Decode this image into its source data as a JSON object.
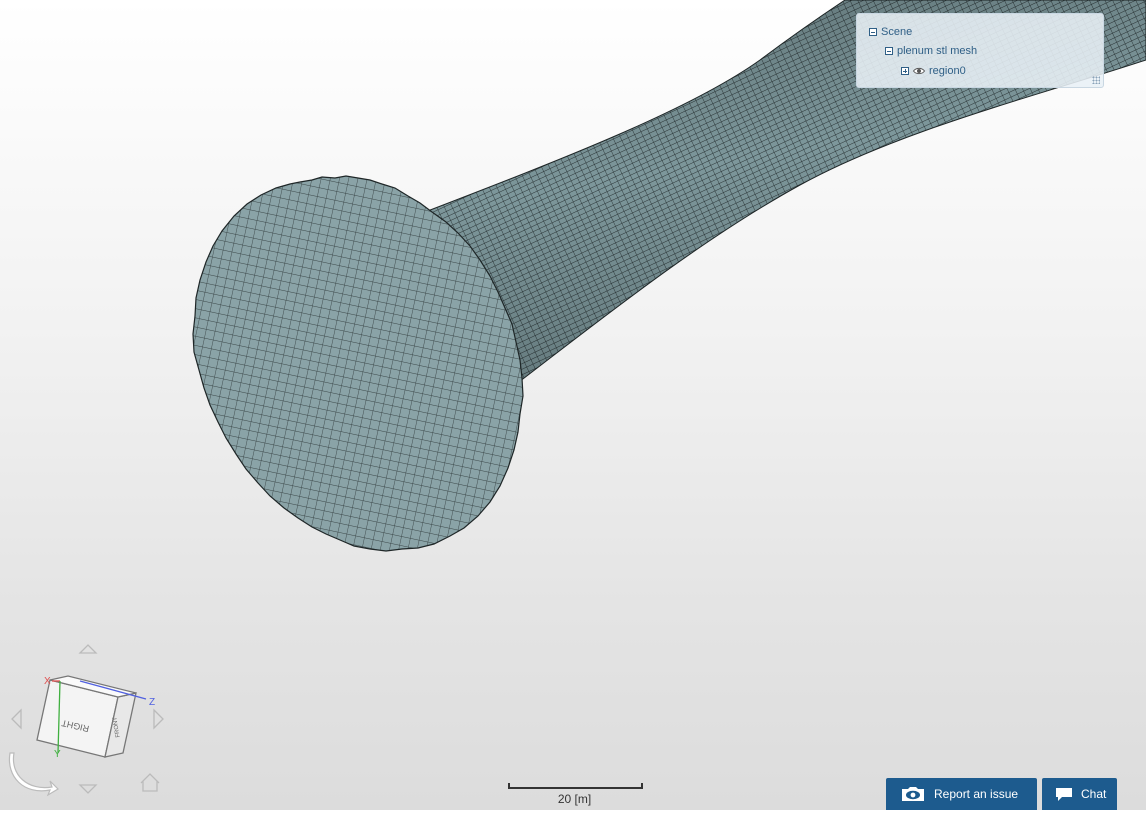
{
  "scene_tree": {
    "root": {
      "label": "Scene",
      "expanded": true
    },
    "mesh": {
      "label": "plenum stl mesh",
      "expanded": true
    },
    "region": {
      "label": "region0",
      "expanded": false,
      "visible": true
    }
  },
  "scale_bar": {
    "label": "20 [m]"
  },
  "buttons": {
    "report_issue": "Report an issue",
    "chat": "Chat"
  },
  "nav_cube": {
    "face_right": "RIGHT",
    "face_front": "FRONT",
    "axis_x": "X",
    "axis_y": "Y",
    "axis_z": "Z"
  },
  "colors": {
    "mesh_fill": "#7d979b",
    "mesh_face": "#8aa3a7",
    "mesh_line": "#2a3436",
    "button_bg": "#1d5b8e",
    "tree_text": "#2f5f86",
    "axis_x": "#e05050",
    "axis_y": "#40b040",
    "axis_z": "#5060e0"
  },
  "icons": {
    "tree_collapse": "minus-box-icon",
    "tree_expand": "plus-box-icon",
    "visibility": "eye-icon",
    "report": "camera-eye-icon",
    "chat": "speech-bubble-icon",
    "home": "home-icon",
    "rotate": "rotate-arrow-icon"
  }
}
